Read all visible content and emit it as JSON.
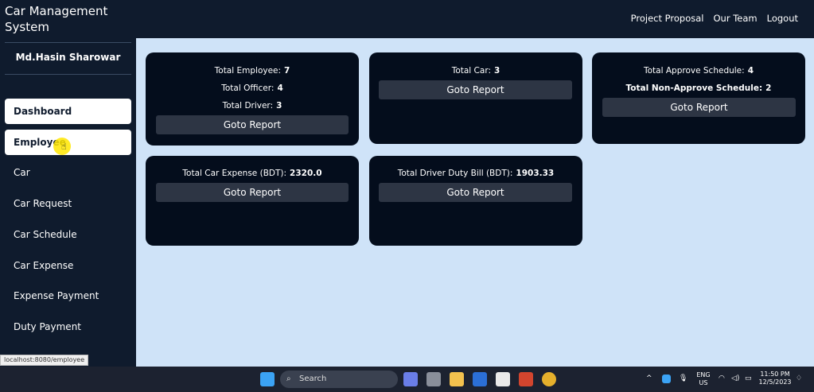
{
  "app": {
    "title": "Car Management System"
  },
  "topnav": {
    "items": [
      "Project Proposal",
      "Our Team",
      "Logout"
    ]
  },
  "sidebar": {
    "user_name": "Md.Hasin Sharowar",
    "items": [
      "Dashboard",
      "Employee",
      "Car",
      "Car Request",
      "Car Schedule",
      "Car Expense",
      "Expense Payment",
      "Duty Payment"
    ]
  },
  "cards": {
    "employee": {
      "lines": [
        {
          "label": "Total Employee:",
          "value": "7"
        },
        {
          "label": "Total Officer:",
          "value": "4"
        },
        {
          "label": "Total Driver:",
          "value": "3"
        }
      ],
      "button": "Goto Report"
    },
    "car": {
      "lines": [
        {
          "label": "Total Car:",
          "value": "3"
        }
      ],
      "button": "Goto Report"
    },
    "schedule": {
      "lines": [
        {
          "label": "Total Approve Schedule:",
          "value": "4"
        },
        {
          "label": "Total Non-Approve Schedule:",
          "value": "2"
        }
      ],
      "button": "Goto Report"
    },
    "expense": {
      "lines": [
        {
          "label": "Total Car Expense (BDT):",
          "value": "2320.0"
        }
      ],
      "button": "Goto Report"
    },
    "duty": {
      "lines": [
        {
          "label": "Total Driver Duty Bill (BDT):",
          "value": "1903.33"
        }
      ],
      "button": "Goto Report"
    }
  },
  "status_bar": {
    "url": "localhost:8080/employee"
  },
  "taskbar": {
    "search_placeholder": "Search",
    "lang": "ENG",
    "region": "US",
    "time": "11:50 PM",
    "date": "12/5/2023"
  },
  "colors": {
    "nav_bg": "#0f1b2d",
    "card_bg": "#040d1c",
    "page_bg": "#cfe3f8",
    "button_bg": "#2d3544"
  }
}
